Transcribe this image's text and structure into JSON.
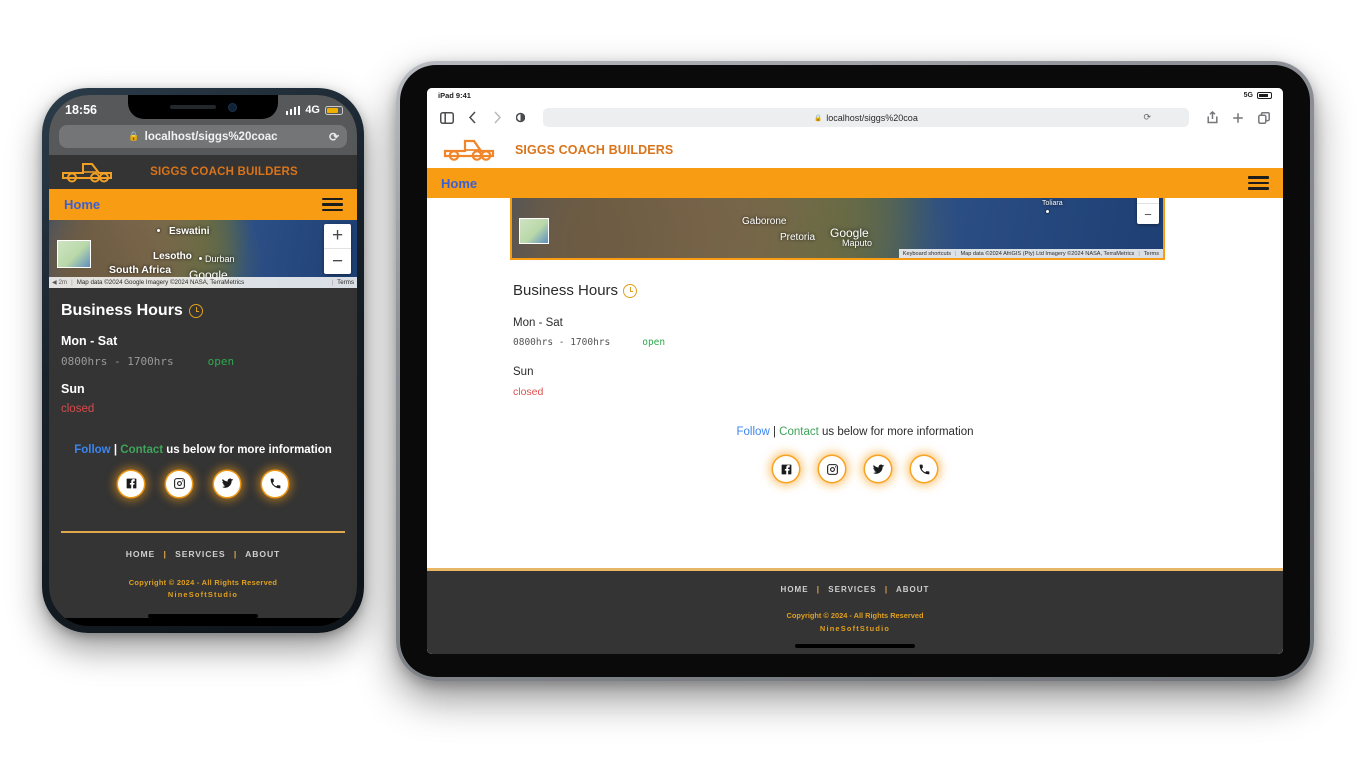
{
  "page": {
    "background": "#ffffff",
    "accent_orange": "#F89C14",
    "dark_surface": "#343434"
  },
  "phone": {
    "status": {
      "time": "18:56",
      "network": "4G"
    },
    "browser": {
      "url": "localhost/siggs%20coac",
      "lock_icon": "lock-icon",
      "reload_icon": "reload-icon"
    },
    "site_header": {
      "logo": "truck-logo",
      "brand": "SIGGS COACH BUILDERS"
    },
    "nav": {
      "home": "Home",
      "menu_icon": "hamburger-menu-icon"
    },
    "map": {
      "places": [
        "Eswatini",
        "Lesotho",
        "Durban",
        "South Africa"
      ],
      "watermark": "Google",
      "zoom_in": "+",
      "zoom_out": "−",
      "attribution": "Map data ©2024 Google  Imagery ©2024 NASA, TerraMetrics",
      "keyboard_shortcuts": "Terms"
    },
    "business_hours": {
      "title": "Business Hours",
      "clock_icon": "clock-icon",
      "weekday_label": "Mon - Sat",
      "weekday_hours": "0800hrs - 1700hrs",
      "weekday_status": "open",
      "sunday_label": "Sun",
      "sunday_status": "closed"
    },
    "follow": {
      "follow": "Follow",
      "divider": "|",
      "contact": "Contact",
      "rest": "us below for more information"
    },
    "socials": [
      "facebook-icon",
      "instagram-icon",
      "twitter-icon",
      "phone-icon"
    ],
    "footer": {
      "links": [
        "HOME",
        "SERVICES",
        "ABOUT"
      ],
      "separator": "|",
      "copyright": "Copyright © 2024 - All Rights Reserved",
      "studio": "NineSoftStudio"
    }
  },
  "tablet": {
    "status": {
      "device": "iPad 9:41",
      "network": "5G"
    },
    "toolbar": {
      "sidebar_icon": "sidebar-toggle-icon",
      "back_icon": "back-arrow-icon",
      "forward_icon": "forward-arrow-icon",
      "reader_icon": "reader-view-icon",
      "url": "localhost/siggs%20coa",
      "lock_icon": "lock-icon",
      "reload_icon": "reload-icon",
      "share_icon": "share-icon",
      "newtab_icon": "new-tab-icon",
      "tabs_icon": "tabs-overview-icon"
    },
    "site_header": {
      "logo": "truck-logo",
      "brand": "SIGGS COACH BUILDERS"
    },
    "nav": {
      "home": "Home",
      "menu_icon": "hamburger-menu-icon"
    },
    "map": {
      "places": [
        "Gaborone",
        "Pretoria",
        "Maputo",
        "Toliara"
      ],
      "watermark": "Google",
      "zoom_in": "+",
      "zoom_out": "−",
      "keyboard_shortcuts": "Keyboard shortcuts",
      "attribution": "Map data ©2024 AfriGIS (Pty) Ltd  Imagery ©2024 NASA, TerraMetrics",
      "terms": "Terms"
    },
    "business_hours": {
      "title": "Business Hours",
      "clock_icon": "clock-icon",
      "weekday_label": "Mon - Sat",
      "weekday_hours": "0800hrs - 1700hrs",
      "weekday_status": "open",
      "sunday_label": "Sun",
      "sunday_status": "closed"
    },
    "follow": {
      "follow": "Follow",
      "divider": "|",
      "contact": "Contact",
      "rest": "us below for more information"
    },
    "socials": [
      "facebook-icon",
      "instagram-icon",
      "twitter-icon",
      "phone-icon"
    ],
    "footer": {
      "links": [
        "HOME",
        "SERVICES",
        "ABOUT"
      ],
      "separator": "|",
      "copyright": "Copyright © 2024 - All Rights Reserved",
      "studio": "NineSoftStudio"
    }
  }
}
